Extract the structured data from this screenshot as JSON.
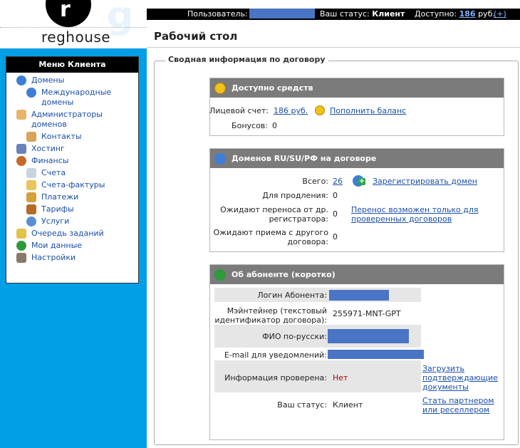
{
  "logo": {
    "text": "reghouse"
  },
  "topbar": {
    "user_label": "Пользователь:",
    "status_label": "Ваш статус:",
    "status_value": "Клиент",
    "available_label": "Доступно:",
    "available_amount": "186",
    "available_currency": "руб.",
    "add_link": "(+)"
  },
  "menu": {
    "title": "Меню Клиента",
    "items": [
      {
        "label": "Домены",
        "icon": "domains-globe-icon"
      },
      {
        "label": "Международные домены",
        "icon": "intl-domains-icon"
      },
      {
        "label": "Администраторы доменов",
        "icon": "admins-icon"
      },
      {
        "label": "Контакты",
        "icon": "contacts-icon"
      },
      {
        "label": "Хостинг",
        "icon": "hosting-icon"
      },
      {
        "label": "Финансы",
        "icon": "finance-icon"
      },
      {
        "label": "Счета",
        "icon": "invoice-icon"
      },
      {
        "label": "Счета-фактуры",
        "icon": "tax-invoice-icon"
      },
      {
        "label": "Платежи",
        "icon": "payments-icon"
      },
      {
        "label": "Тарифы",
        "icon": "tariffs-icon"
      },
      {
        "label": "Услуги",
        "icon": "services-icon"
      },
      {
        "label": "Очередь заданий",
        "icon": "queue-icon"
      },
      {
        "label": "Мои данные",
        "icon": "info-icon"
      },
      {
        "label": "Настройки",
        "icon": "settings-icon"
      }
    ]
  },
  "page": {
    "title": "Рабочий стол",
    "legend": "Сводная информация по договору"
  },
  "funds": {
    "header": "Доступно средств",
    "account_label": "Лицевой счет:",
    "account_value": "186 руб.",
    "topup_link": "Пополнить баланс",
    "bonus_label": "Бонусов:",
    "bonus_value": "0"
  },
  "domains": {
    "header": "Доменов RU/SU/РФ на договоре",
    "total_label": "Всего:",
    "total_value": "26",
    "register_link": "Зарегистрировать домен",
    "renew_label": "Для продления:",
    "renew_value": "0",
    "transfer_out_label_1": "Ожидают переноса от др.",
    "transfer_out_label_2": "регистратора:",
    "transfer_out_value": "0",
    "transfer_link_1": "Перенос возможен только для",
    "transfer_link_2": "проверенных договоров",
    "transfer_in_label_1": "Ожидают приема с другого",
    "transfer_in_label_2": "договора:",
    "transfer_in_value": "0"
  },
  "subscriber": {
    "header": "Об абоненте (коротко)",
    "login_label": "Логин Абонента:",
    "maintainer_label_1": "Мэйнтейнер (текстовый",
    "maintainer_label_2": "идентификатор договора):",
    "maintainer_value": "255971-MNT-GPT",
    "fio_label": "ФИО по-русски:",
    "email_label": "E-mail для уведомлений:",
    "verified_label": "Информация проверена:",
    "verified_value": "Нет",
    "upload_link_1": "Загрузить",
    "upload_link_2": "подтверждающие",
    "upload_link_3": "документы",
    "status_label": "Ваш статус:",
    "status_value": "Клиент",
    "partner_link_1": "Стать партнером",
    "partner_link_2": "или реселлером"
  },
  "colors": {
    "sidebar_bg": "#009fe6",
    "panel_header": "#7b7b7b",
    "link": "#1a4fa8",
    "negative": "#b30000"
  }
}
